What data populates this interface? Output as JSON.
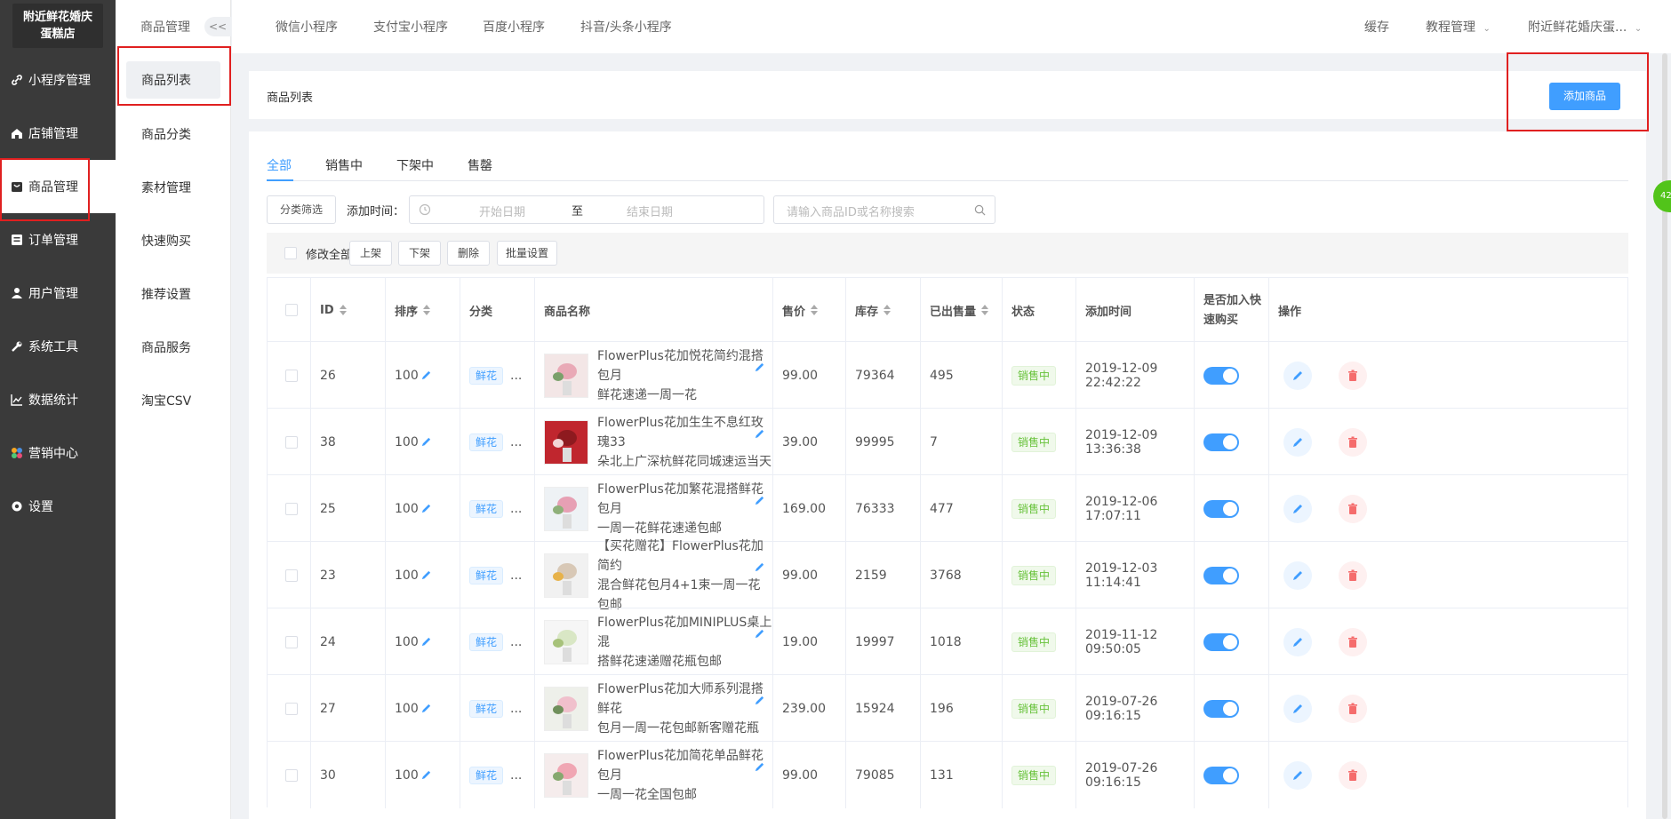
{
  "store": {
    "name_line1": "附近鲜花婚庆",
    "name_line2": "蛋糕店"
  },
  "sidebar": {
    "items": [
      {
        "label": "小程序管理",
        "icon": "link-icon"
      },
      {
        "label": "店铺管理",
        "icon": "home-icon"
      },
      {
        "label": "商品管理",
        "icon": "bag-icon"
      },
      {
        "label": "订单管理",
        "icon": "order-icon"
      },
      {
        "label": "用户管理",
        "icon": "user-icon"
      },
      {
        "label": "系统工具",
        "icon": "wrench-icon"
      },
      {
        "label": "数据统计",
        "icon": "chart-icon"
      },
      {
        "label": "营销中心",
        "icon": "marketing-icon"
      },
      {
        "label": "设置",
        "icon": "settings-icon"
      }
    ]
  },
  "submenu": {
    "header": "商品管理",
    "collapse": "<<",
    "items": [
      "商品列表",
      "商品分类",
      "素材管理",
      "快速购买",
      "推荐设置",
      "商品服务",
      "淘宝CSV"
    ]
  },
  "topbar": {
    "tabs": [
      "微信小程序",
      "支付宝小程序",
      "百度小程序",
      "抖音/头条小程序"
    ],
    "cache": "缓存",
    "tutorial": "教程管理",
    "account": "附近鲜花婚庆蛋..."
  },
  "page": {
    "title": "商品列表",
    "add_button": "添加商品"
  },
  "status_tabs": [
    "全部",
    "销售中",
    "下架中",
    "售罄"
  ],
  "filters": {
    "category_button": "分类筛选",
    "time_label": "添加时间：",
    "start_placeholder": "开始日期",
    "separator": "至",
    "end_placeholder": "结束日期",
    "search_placeholder": "请输入商品ID或名称搜索"
  },
  "bulk": {
    "select_all": "修改全部",
    "buttons": [
      "上架",
      "下架",
      "删除",
      "批量设置"
    ]
  },
  "table": {
    "headers": {
      "id": "ID",
      "sort": "排序",
      "category": "分类",
      "name": "商品名称",
      "price": "售价",
      "stock": "库存",
      "sold": "已出售量",
      "status": "状态",
      "added": "添加时间",
      "quick_buy_1": "是否加入快",
      "quick_buy_2": "速购买",
      "ops": "操作"
    },
    "rows": [
      {
        "id": "26",
        "sort": "100",
        "category": "鲜花",
        "more": "...",
        "name_1": "FlowerPlus花加悦花简约混搭包月",
        "name_2": "鲜花速递一周一花",
        "price": "99.00",
        "stock": "79364",
        "sold": "495",
        "status": "销售中",
        "added": "2019-12-09 22:42:22",
        "quick_buy": true
      },
      {
        "id": "38",
        "sort": "100",
        "category": "鲜花",
        "more": "...",
        "name_1": "FlowerPlus花加生生不息红玫瑰33",
        "name_2": "朵北上广深杭鲜花同城速运当天",
        "price": "39.00",
        "stock": "99995",
        "sold": "7",
        "status": "销售中",
        "added": "2019-12-09 13:36:38",
        "quick_buy": true
      },
      {
        "id": "25",
        "sort": "100",
        "category": "鲜花",
        "more": "...",
        "name_1": "FlowerPlus花加繁花混搭鲜花包月",
        "name_2": "一周一花鲜花速递包邮",
        "price": "169.00",
        "stock": "76333",
        "sold": "477",
        "status": "销售中",
        "added": "2019-12-06 17:07:11",
        "quick_buy": true
      },
      {
        "id": "23",
        "sort": "100",
        "category": "鲜花",
        "more": "...",
        "name_1": "【买花赠花】FlowerPlus花加简约",
        "name_2": "混合鲜花包月4+1束一周一花包邮",
        "price": "99.00",
        "stock": "2159",
        "sold": "3768",
        "status": "销售中",
        "added": "2019-12-03 11:14:41",
        "quick_buy": true
      },
      {
        "id": "24",
        "sort": "100",
        "category": "鲜花",
        "more": "...",
        "name_1": "FlowerPlus花加MINIPLUS桌上混",
        "name_2": "搭鲜花速递赠花瓶包邮",
        "price": "19.00",
        "stock": "19997",
        "sold": "1018",
        "status": "销售中",
        "added": "2019-11-12 09:50:05",
        "quick_buy": true
      },
      {
        "id": "27",
        "sort": "100",
        "category": "鲜花",
        "more": "...",
        "name_1": "FlowerPlus花加大师系列混搭鲜花",
        "name_2": "包月一周一花包邮新客赠花瓶",
        "price": "239.00",
        "stock": "15924",
        "sold": "196",
        "status": "销售中",
        "added": "2019-07-26 09:16:15",
        "quick_buy": true
      },
      {
        "id": "30",
        "sort": "100",
        "category": "鲜花",
        "more": "...",
        "name_1": "FlowerPlus花加简花单品鲜花包月",
        "name_2": "一周一花全国包邮",
        "price": "99.00",
        "stock": "79085",
        "sold": "131",
        "status": "销售中",
        "added": "2019-07-26 09:16:15",
        "quick_buy": true
      }
    ]
  },
  "colors": {
    "primary": "#409eff",
    "sidebar": "#3a3a3a",
    "success": "#67c23a",
    "danger": "#f56c6c",
    "highlight": "#e02020"
  },
  "float_badge": "42"
}
